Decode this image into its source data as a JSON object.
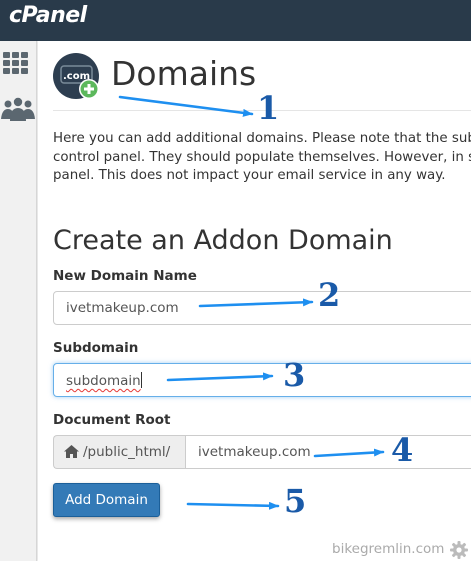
{
  "app": {
    "brand": "cPanel"
  },
  "sidebar": {
    "icons": [
      "grid-icon",
      "users-icon"
    ]
  },
  "page": {
    "title": "Domains",
    "description_lines": [
      "Here you can add additional domains. Please note that the subd",
      "control panel. They should populate themselves. However, in sor",
      "panel. This does not impact your email service in any way."
    ]
  },
  "form": {
    "title": "Create an Addon Domain",
    "new_domain": {
      "label": "New Domain Name",
      "value": "ivetmakeup.com"
    },
    "subdomain": {
      "label": "Subdomain",
      "value": "subdomain"
    },
    "document_root": {
      "label": "Document Root",
      "prefix": "/public_html/",
      "value": "ivetmakeup.com"
    },
    "submit_label": "Add Domain"
  },
  "annotations": {
    "n1": "1",
    "n2": "2",
    "n3": "3",
    "n4": "4",
    "n5": "5"
  },
  "watermark": "bikegremlin.com",
  "colors": {
    "topbar": "#293a4a",
    "button": "#337ab7",
    "annotation": "#1a5aa8",
    "arrow": "#1e8ff0"
  }
}
